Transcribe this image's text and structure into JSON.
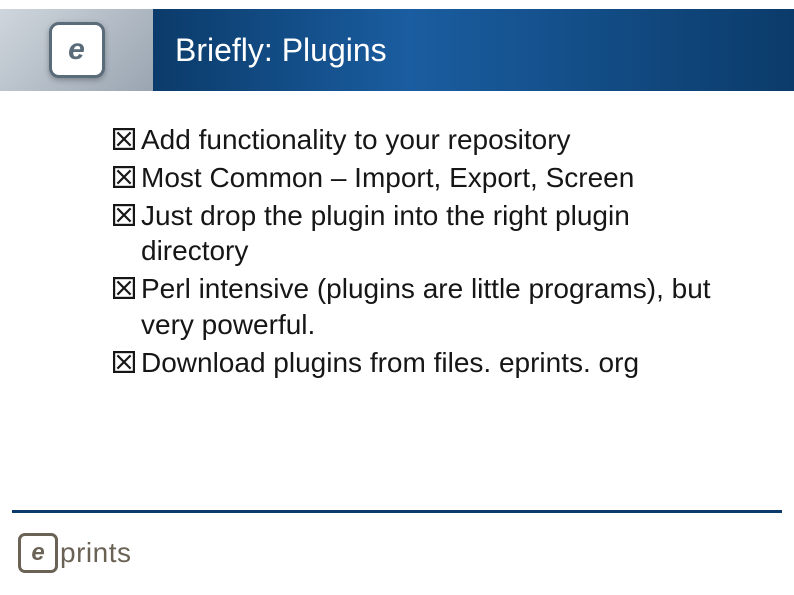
{
  "header": {
    "icon_glyph": "e",
    "title": "Briefly: Plugins"
  },
  "bullets": [
    {
      "text": "Add functionality to your repository"
    },
    {
      "text": "Most Common – Import, Export, Screen"
    },
    {
      "text": "Just drop the plugin into the right plugin directory"
    },
    {
      "text": "Perl intensive (plugins are little programs), but very powerful."
    },
    {
      "text": "Download plugins from files. eprints. org"
    }
  ],
  "footer": {
    "logo_glyph": "e",
    "logo_text": "prints"
  }
}
